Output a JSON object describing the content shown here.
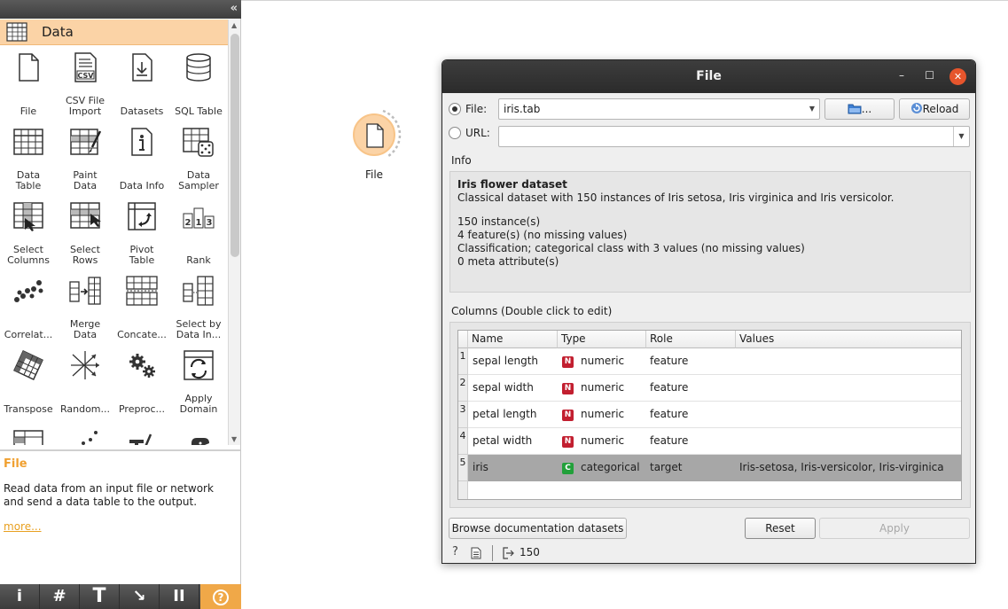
{
  "toolbox": {
    "category": "Data",
    "collapse_glyph": "«",
    "widgets": [
      {
        "label": "File",
        "icon": "file-icon"
      },
      {
        "label": "CSV File\nImport",
        "icon": "csv-file-icon"
      },
      {
        "label": "Datasets",
        "icon": "datasets-icon"
      },
      {
        "label": "SQL Table",
        "icon": "sql-table-icon"
      },
      {
        "label": "Data\nTable",
        "icon": "data-table-icon"
      },
      {
        "label": "Paint\nData",
        "icon": "paint-data-icon"
      },
      {
        "label": "Data Info",
        "icon": "data-info-icon"
      },
      {
        "label": "Data\nSampler",
        "icon": "data-sampler-icon"
      },
      {
        "label": "Select\nColumns",
        "icon": "select-columns-icon"
      },
      {
        "label": "Select\nRows",
        "icon": "select-rows-icon"
      },
      {
        "label": "Pivot\nTable",
        "icon": "pivot-table-icon"
      },
      {
        "label": "Rank",
        "icon": "rank-icon"
      },
      {
        "label": "Correlat...",
        "icon": "correlations-icon"
      },
      {
        "label": "Merge\nData",
        "icon": "merge-data-icon"
      },
      {
        "label": "Concate...",
        "icon": "concatenate-icon"
      },
      {
        "label": "Select by\nData In...",
        "icon": "select-by-data-index-icon"
      },
      {
        "label": "Transpose",
        "icon": "transpose-icon"
      },
      {
        "label": "Random...",
        "icon": "randomize-icon"
      },
      {
        "label": "Preproc...",
        "icon": "preprocess-icon"
      },
      {
        "label": "Apply\nDomain",
        "icon": "apply-domain-icon"
      }
    ],
    "rank_digits": "213"
  },
  "help": {
    "title": "File",
    "text": "Read data from an input file or network and send a data table to the output.",
    "more": "more..."
  },
  "bottom_toolbar": {
    "info": "i",
    "grid": "#",
    "text": "T",
    "arrow": "↘",
    "pause": "II",
    "help": "?"
  },
  "canvas": {
    "node_label": "File"
  },
  "dialog": {
    "title": "File",
    "window_controls": {
      "minimize": "–",
      "maximize": "☐",
      "close": "✕"
    },
    "file_label": "File:",
    "file_value": "iris.tab",
    "url_label": "URL:",
    "url_value": "",
    "browse_label": "...",
    "reload_label": "Reload",
    "info_heading": "Info",
    "info": {
      "title": "Iris flower dataset",
      "description": "Classical dataset with 150 instances of Iris setosa, Iris virginica and Iris versicolor.",
      "lines": [
        "150 instance(s)",
        "4 feature(s) (no missing values)",
        "Classification; categorical class with 3 values (no missing values)",
        "0 meta attribute(s)"
      ]
    },
    "columns_heading": "Columns (Double click to edit)",
    "columns_headers": [
      "Name",
      "Type",
      "Role",
      "Values"
    ],
    "columns_rows": [
      {
        "num": "1",
        "name": "sepal length",
        "badge": "N",
        "type": "numeric",
        "role": "feature",
        "values": ""
      },
      {
        "num": "2",
        "name": "sepal width",
        "badge": "N",
        "type": "numeric",
        "role": "feature",
        "values": ""
      },
      {
        "num": "3",
        "name": "petal length",
        "badge": "N",
        "type": "numeric",
        "role": "feature",
        "values": ""
      },
      {
        "num": "4",
        "name": "petal width",
        "badge": "N",
        "type": "numeric",
        "role": "feature",
        "values": ""
      },
      {
        "num": "5",
        "name": "iris",
        "badge": "C",
        "type": "categorical",
        "role": "target",
        "values": "Iris-setosa, Iris-versicolor, Iris-virginica"
      }
    ],
    "badge_colors": {
      "N": "#c21f30",
      "C": "#22a03a"
    },
    "browse_docs_label": "Browse documentation datasets",
    "reset_label": "Reset",
    "apply_label": "Apply",
    "status_help": "?",
    "status_output_count": "150"
  },
  "colors": {
    "accent": "#f0a848",
    "category_bg": "#fbd3a6",
    "selected_row": "#a7a7a7"
  }
}
